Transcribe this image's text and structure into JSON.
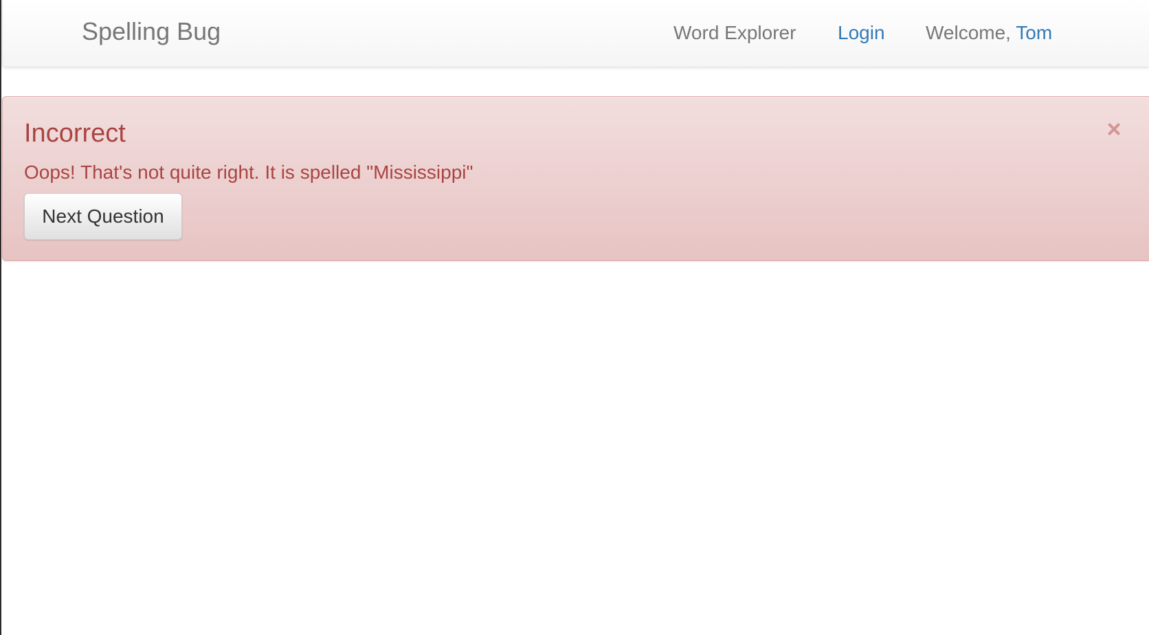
{
  "navbar": {
    "brand": "Spelling Bug",
    "links": {
      "word_explorer": "Word Explorer",
      "login": "Login"
    },
    "welcome_prefix": "Welcome, ",
    "user_name": "Tom"
  },
  "alert": {
    "title": "Incorrect",
    "message": "Oops! That's not quite right. It is spelled \"Mississippi\"",
    "close_glyph": "×",
    "next_button_label": "Next Question"
  },
  "colors": {
    "alert_text": "#a94442",
    "alert_background": "#f2dede",
    "link": "#337ab7",
    "nav_text": "#777777"
  }
}
